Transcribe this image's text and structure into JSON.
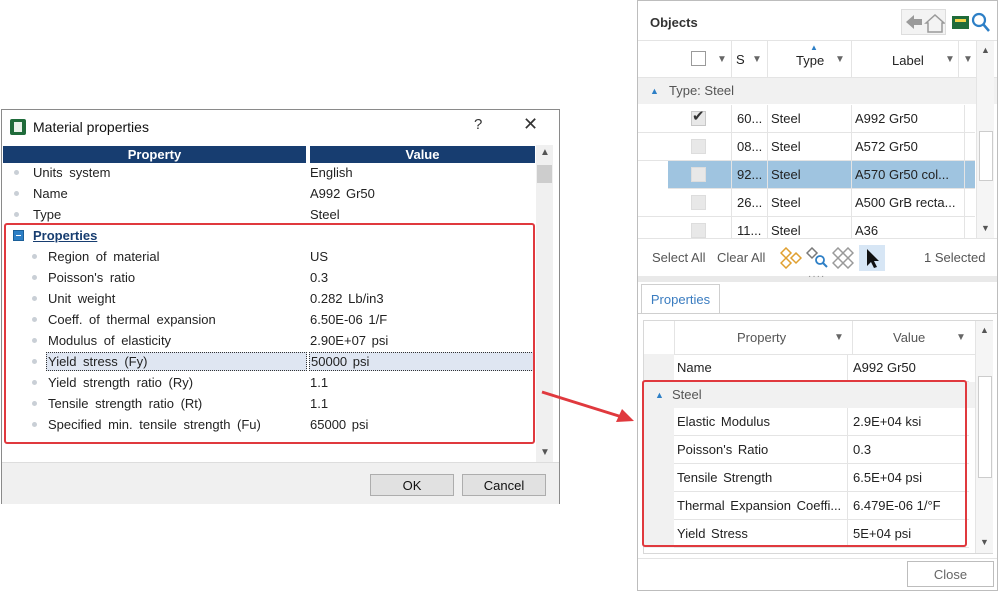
{
  "dialog": {
    "title": "Material properties",
    "help": "?",
    "close": "✕",
    "col_property": "Property",
    "col_value": "Value",
    "rows": [
      {
        "label": "Units system",
        "value": "English"
      },
      {
        "label": "Name",
        "value": "A992 Gr50"
      },
      {
        "label": "Type",
        "value": "Steel"
      }
    ],
    "group_label": "Properties",
    "group_rows": [
      {
        "label": "Region of material",
        "value": "US"
      },
      {
        "label": "Poisson's ratio",
        "value": "0.3"
      },
      {
        "label": "Unit weight",
        "value": "0.282 Lb/in3"
      },
      {
        "label": "Coeff. of thermal expansion",
        "value": "6.50E-06 1/F"
      },
      {
        "label": "Modulus of elasticity",
        "value": "2.90E+07 psi"
      },
      {
        "label": "Yield stress (Fy)",
        "value": "50000 psi"
      },
      {
        "label": "Yield strength ratio (Ry)",
        "value": "1.1"
      },
      {
        "label": "Tensile strength ratio (Rt)",
        "value": "1.1"
      },
      {
        "label": "Specified min. tensile strength (Fu)",
        "value": "65000 psi"
      }
    ],
    "ok_label": "OK",
    "cancel_label": "Cancel"
  },
  "objects": {
    "title": "Objects",
    "col_s": "S",
    "col_type": "Type",
    "col_label": "Label",
    "group": "Type: Steel",
    "rows": [
      {
        "s": "60...",
        "type": "Steel",
        "label": "A992 Gr50",
        "checked": true
      },
      {
        "s": "08...",
        "type": "Steel",
        "label": "A572 Gr50",
        "checked": false
      },
      {
        "s": "92...",
        "type": "Steel",
        "label": "A570 Gr50 col...",
        "checked": false,
        "selected": true
      },
      {
        "s": "26...",
        "type": "Steel",
        "label": "A500 GrB recta...",
        "checked": false
      },
      {
        "s": "11...",
        "type": "Steel",
        "label": "A36",
        "checked": false
      }
    ],
    "select_all": "Select All",
    "clear_all": "Clear All",
    "selected_count": "1 Selected"
  },
  "properties": {
    "tab": "Properties",
    "col_property": "Property",
    "col_value": "Value",
    "name_label": "Name",
    "name_value": "A992 Gr50",
    "group": "Steel",
    "rows": [
      {
        "label": "Elastic Modulus",
        "value": "2.9E+04 ksi"
      },
      {
        "label": "Poisson's Ratio",
        "value": "0.3"
      },
      {
        "label": "Tensile Strength",
        "value": "6.5E+04 psi"
      },
      {
        "label": "Thermal Expansion Coeffi...",
        "value": "6.479E-06 1/°F"
      },
      {
        "label": "Yield Stress",
        "value": "5E+04 psi"
      }
    ],
    "close_label": "Close"
  },
  "colors": {
    "header_navy": "#173d70",
    "highlight_red": "#e0393e",
    "selected_row": "#9fc4e0",
    "tab_blue": "#3a7cc0"
  }
}
